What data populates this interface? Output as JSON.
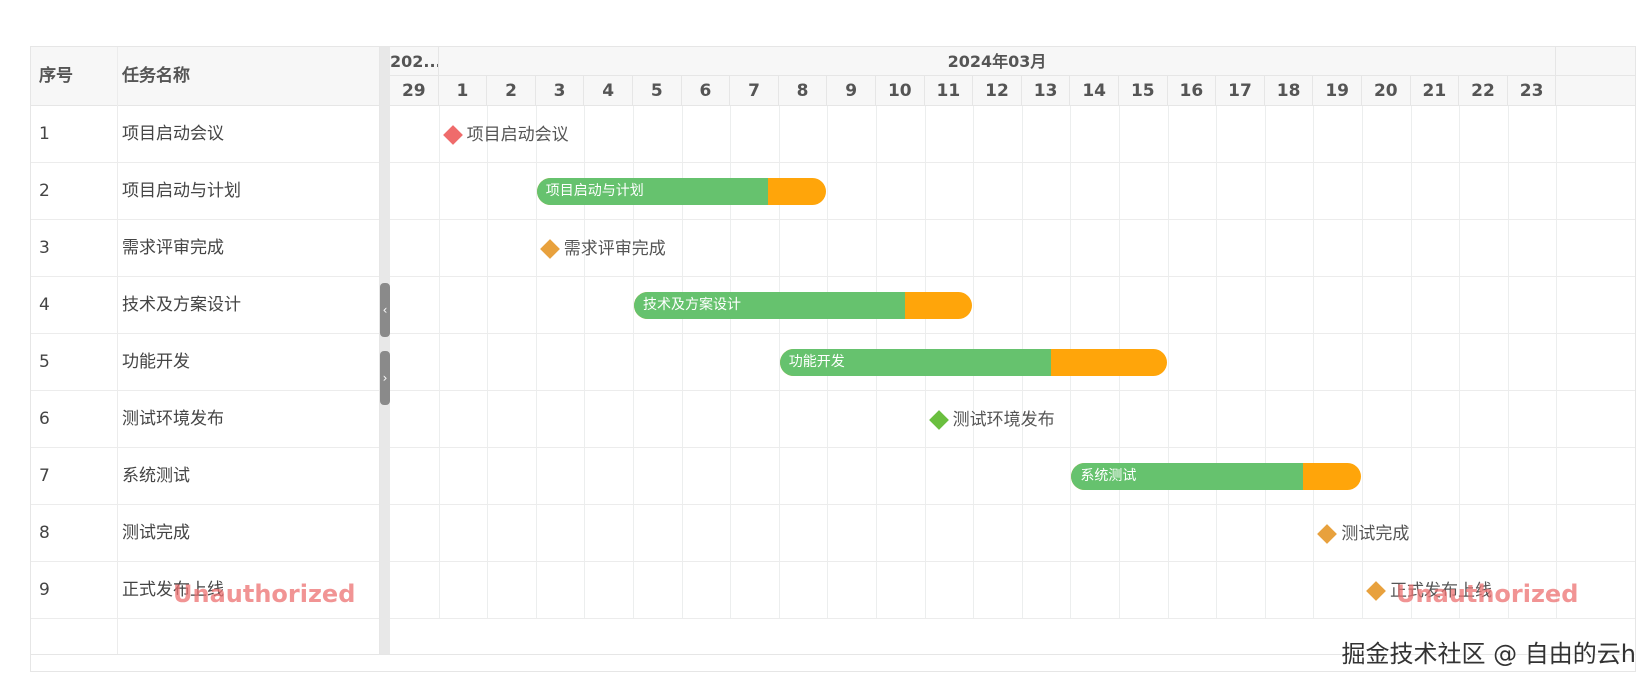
{
  "grid": {
    "headers": {
      "index": "序号",
      "name": "任务名称"
    }
  },
  "scale": {
    "months": [
      {
        "label": "202..."
      },
      {
        "label": "2024年03月"
      }
    ],
    "days": [
      "29",
      "1",
      "2",
      "3",
      "4",
      "5",
      "6",
      "7",
      "8",
      "9",
      "10",
      "11",
      "12",
      "13",
      "14",
      "15",
      "16",
      "17",
      "18",
      "19",
      "20",
      "21",
      "22",
      "23"
    ]
  },
  "tasks": [
    {
      "index": "1",
      "name": "项目启动会议",
      "type": "milestone",
      "label": "项目启动会议",
      "day": 1,
      "color": "#ef6b6b"
    },
    {
      "index": "2",
      "name": "项目启动与计划",
      "type": "task",
      "label": "项目启动与计划",
      "start": 3,
      "duration": 6,
      "progress": 0.8
    },
    {
      "index": "3",
      "name": "需求评审完成",
      "type": "milestone",
      "label": "需求评审完成",
      "day": 3,
      "color": "#e8a13d"
    },
    {
      "index": "4",
      "name": "技术及方案设计",
      "type": "task",
      "label": "技术及方案设计",
      "start": 5,
      "duration": 7,
      "progress": 0.8
    },
    {
      "index": "5",
      "name": "功能开发",
      "type": "task",
      "label": "功能开发",
      "start": 8,
      "duration": 8,
      "progress": 0.7
    },
    {
      "index": "6",
      "name": "测试环境发布",
      "type": "milestone",
      "label": "测试环境发布",
      "day": 11,
      "color": "#6abf3f"
    },
    {
      "index": "7",
      "name": "系统测试",
      "type": "task",
      "label": "系统测试",
      "start": 14,
      "duration": 6,
      "progress": 0.8
    },
    {
      "index": "8",
      "name": "测试完成",
      "type": "milestone",
      "label": "测试完成",
      "day": 19,
      "color": "#e8a13d"
    },
    {
      "index": "9",
      "name": "正式发布上线",
      "type": "milestone",
      "label": "正式发布上线",
      "day": 20,
      "color": "#e8a13d"
    }
  ],
  "colors": {
    "progress": "#66c26e",
    "remaining": "#ffa50a"
  },
  "splitter": {
    "collapse_icon": "chevron-left-icon",
    "collapse_glyph": "‹",
    "expand_icon": "chevron-right-icon",
    "expand_glyph": "›"
  },
  "watermarks": {
    "unauthorized": "Unauthorized",
    "footer": "掘金技术社区 @ 自由的云h"
  }
}
